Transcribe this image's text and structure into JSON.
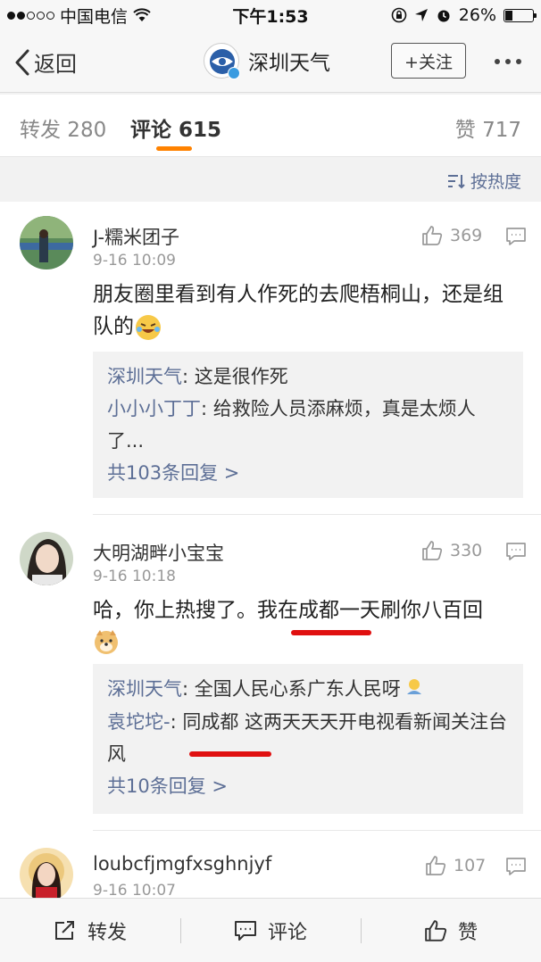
{
  "status_bar": {
    "carrier": "中国电信",
    "time": "下午1:53",
    "battery": "26%",
    "battery_level": 0.26
  },
  "nav": {
    "back_label": "返回",
    "title": "深圳天气",
    "follow_label": "+关注"
  },
  "tabs": {
    "repost": "转发 280",
    "comment": "评论 615",
    "like": "赞 717"
  },
  "sort_label": "按热度",
  "comments": [
    {
      "user": "J-糯米团子",
      "time": "9-16 10:09",
      "likes": "369",
      "text": "朋友圈里看到有人作死的去爬梧桐山，还是组队的",
      "replies": [
        {
          "name": "深圳天气",
          "text": ": 这是很作死"
        },
        {
          "name": "小小小丁丁",
          "text": ": 给救险人员添麻烦，真是太烦人了..."
        }
      ],
      "more_replies": "共103条回复 >"
    },
    {
      "user": "大明湖畔小宝宝",
      "time": "9-16 10:18",
      "likes": "330",
      "text": "哈，你上热搜了。我在成都一天刷你八百回",
      "replies": [
        {
          "name": "深圳天气",
          "text": ": 全国人民心系广东人民呀"
        },
        {
          "name": "袁坨坨-",
          "text": ": 同成都 这两天天天开电视看新闻关注台风"
        }
      ],
      "more_replies": "共10条回复 >"
    },
    {
      "user": "loubcfjmgfxsghnjyf",
      "time": "9-16 10:07",
      "likes": "107"
    }
  ],
  "toolbar": {
    "repost": "转发",
    "comment": "评论",
    "like": "赞"
  },
  "colors": {
    "accent": "#ff8200",
    "link": "#5d6f96",
    "annotation_red": "#e01010"
  }
}
